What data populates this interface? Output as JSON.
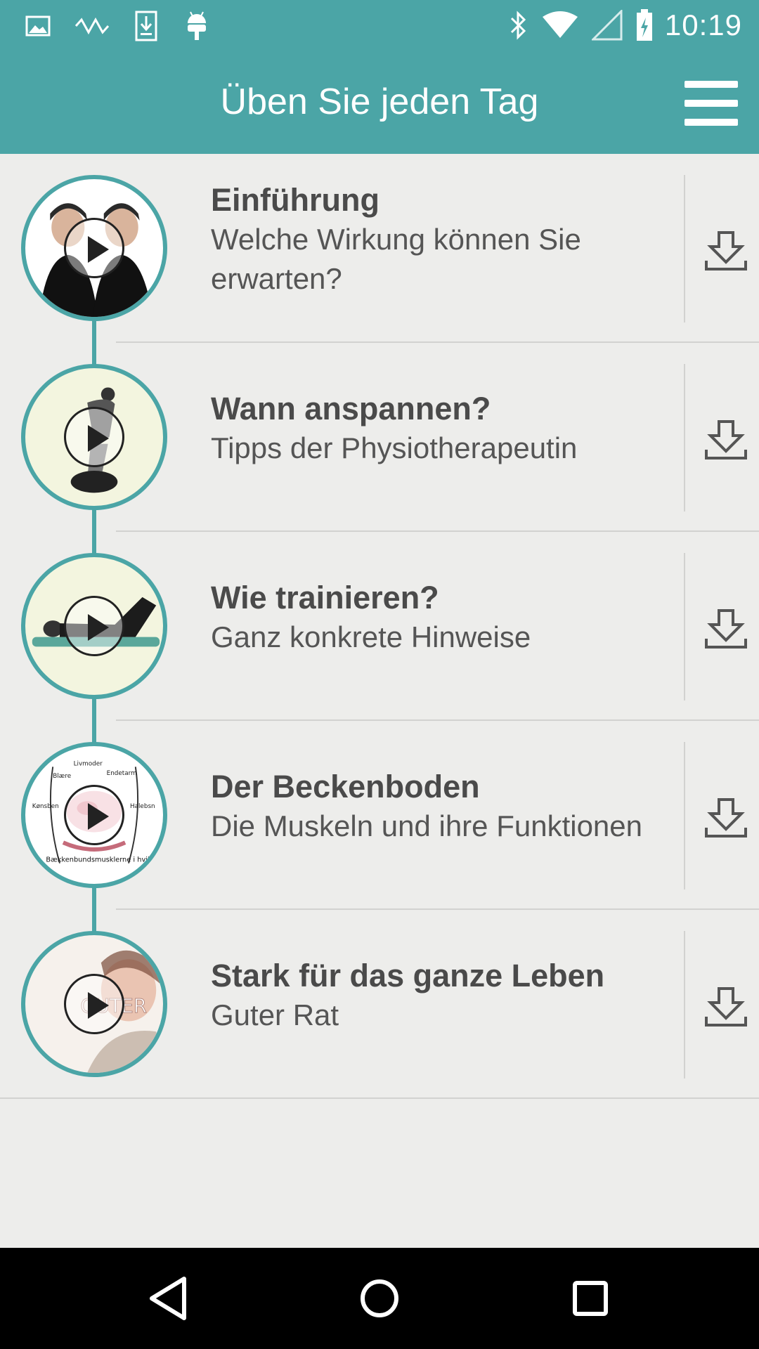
{
  "status_bar": {
    "time": "10:19",
    "left_icons": [
      "image-icon",
      "signal-wave-icon",
      "download-notification-icon",
      "android-icon"
    ],
    "right_icons": [
      "bluetooth-icon",
      "wifi-icon",
      "cell-signal-icon",
      "battery-icon"
    ]
  },
  "app_bar": {
    "title": "Üben Sie jeden Tag",
    "menu_icon": "hamburger-menu-icon"
  },
  "colors": {
    "accent": "#4ba5a6",
    "background": "#ededeb",
    "text": "#4a4a4a"
  },
  "lessons": [
    {
      "title": "Einführung",
      "subtitle": "Welche Wirkung können Sie erwarten?",
      "thumbnail": "two-women-portrait"
    },
    {
      "title": "Wann anspannen?",
      "subtitle": "Tipps der Physiotherapeutin",
      "thumbnail": "woman-lifting-car-seat"
    },
    {
      "title": "Wie trainieren?",
      "subtitle": "Ganz konkrete Hinweise",
      "thumbnail": "woman-lying-on-mat"
    },
    {
      "title": "Der Beckenboden",
      "subtitle": "Die Muskeln und ihre Funktionen",
      "thumbnail": "pelvic-floor-diagram"
    },
    {
      "title": "Stark für das ganze Leben",
      "subtitle": "Guter Rat",
      "thumbnail": "guter-rat-photo"
    }
  ],
  "thumbnail_texts": {
    "diagram_caption": "Bækkenbundsmusklerne i hvile",
    "diagram_labels": [
      "Livmoder",
      "Blære",
      "Endetarm",
      "Kønsben",
      "Halebsn"
    ],
    "photo_overlay": "GUTER"
  },
  "nav_bar": {
    "back": "back-icon",
    "home": "home-icon",
    "recents": "recents-icon"
  }
}
